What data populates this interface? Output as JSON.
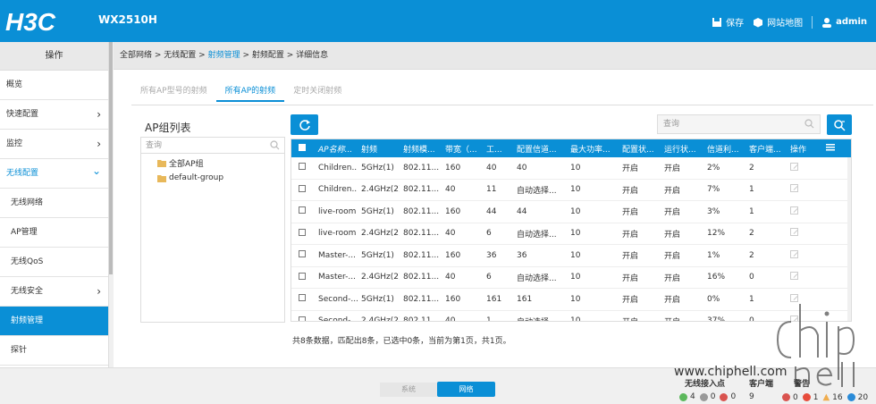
{
  "header": {
    "brand": "H3C",
    "model": "WX2510H",
    "save": "保存",
    "sitemap": "网站地图",
    "user": "admin"
  },
  "sidebar": {
    "title": "操作",
    "items": [
      {
        "label": "概览",
        "chevron": ""
      },
      {
        "label": "快速配置",
        "chevron": "›"
      },
      {
        "label": "监控",
        "chevron": "›"
      },
      {
        "label": "无线配置",
        "chevron": "⌄"
      },
      {
        "label": "无线网络",
        "chevron": ""
      },
      {
        "label": "AP管理",
        "chevron": ""
      },
      {
        "label": "无线QoS",
        "chevron": ""
      },
      {
        "label": "无线安全",
        "chevron": "›"
      },
      {
        "label": "射频管理",
        "chevron": ""
      },
      {
        "label": "探针",
        "chevron": ""
      }
    ]
  },
  "breadcrumb": {
    "p1": "全部网络",
    "p2": "无线配置",
    "p3": "射频管理",
    "p4": "射频配置",
    "p5": "详细信息",
    "sep": " > "
  },
  "tabs": [
    "所有AP型号的射频",
    "所有AP的射频",
    "定时关闭射频"
  ],
  "ap_group": {
    "title": "AP组列表",
    "search_placeholder": "查询",
    "items": [
      "全部AP组",
      "default-group"
    ]
  },
  "search": {
    "placeholder": "查询"
  },
  "table": {
    "columns": [
      "AP名称...",
      "射频",
      "射频模...",
      "带宽（...",
      "工...",
      "配置信道...",
      "最大功率...",
      "配置状...",
      "运行状...",
      "信道利...",
      "客户端...",
      "操作"
    ],
    "rows": [
      [
        "Children...",
        "5GHz(1)",
        "802.11...",
        "160",
        "40",
        "40",
        "10",
        "开启",
        "开启",
        "2%",
        "2"
      ],
      [
        "Children...",
        "2.4GHz(2)",
        "802.11...",
        "40",
        "11",
        "自动选择...",
        "10",
        "开启",
        "开启",
        "7%",
        "1"
      ],
      [
        "live-room",
        "5GHz(1)",
        "802.11...",
        "160",
        "44",
        "44",
        "10",
        "开启",
        "开启",
        "3%",
        "1"
      ],
      [
        "live-room",
        "2.4GHz(2)",
        "802.11...",
        "40",
        "6",
        "自动选择...",
        "10",
        "开启",
        "开启",
        "12%",
        "2"
      ],
      [
        "Master-...",
        "5GHz(1)",
        "802.11...",
        "160",
        "36",
        "36",
        "10",
        "开启",
        "开启",
        "1%",
        "2"
      ],
      [
        "Master-...",
        "2.4GHz(2)",
        "802.11...",
        "40",
        "6",
        "自动选择...",
        "10",
        "开启",
        "开启",
        "16%",
        "0"
      ],
      [
        "Second-...",
        "5GHz(1)",
        "802.11...",
        "160",
        "161",
        "161",
        "10",
        "开启",
        "开启",
        "0%",
        "1"
      ],
      [
        "Second-...",
        "2.4GHz(2)",
        "802.11...",
        "40",
        "1",
        "自动选择...",
        "10",
        "开启",
        "开启",
        "37%",
        "0"
      ]
    ]
  },
  "summary": "共8条数据，匹配出8条，已选中0条，当前为第1页，共1页。",
  "bottom": {
    "tab_system": "系统",
    "tab_network": "网络",
    "ap_label": "无线接入点",
    "ap_ok": "4",
    "ap_mid": "0",
    "ap_err": "0",
    "client_label": "客户端",
    "client_count": "9",
    "alarm_label": "警告",
    "alarm_critical": "0",
    "alarm_major": "1",
    "alarm_minor": "16",
    "alarm_info": "20"
  },
  "watermark": {
    "text": "www.chiphell.com"
  },
  "colors": {
    "accent": "#0a8fd6"
  }
}
